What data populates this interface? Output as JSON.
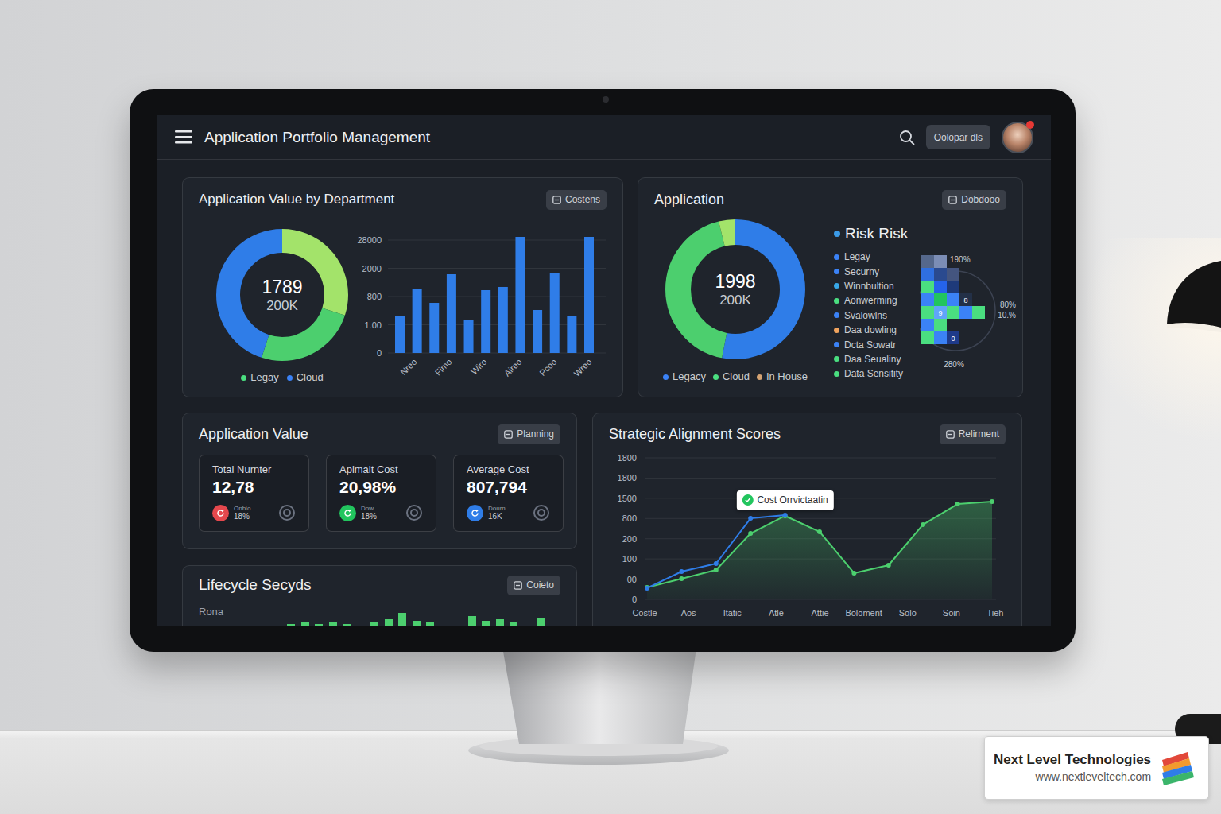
{
  "header": {
    "title": "Application Portfolio Management",
    "button": "Oolopar dls",
    "notification": true
  },
  "department_value": {
    "title": "Application Value by Department",
    "button": "Costens",
    "donut": {
      "value": "1789",
      "sub": "200K",
      "segments": [
        {
          "value": 30,
          "color": "#a3e36a"
        },
        {
          "value": 25,
          "color": "#4ccf6e"
        },
        {
          "value": 45,
          "color": "#2f7de8"
        }
      ]
    },
    "legend": [
      {
        "label": "Legay",
        "color": "#4ade80"
      },
      {
        "label": "Cloud",
        "color": "#3b82f6"
      }
    ],
    "bars": {
      "ticks": [
        "0",
        "1.00",
        "800",
        "2000",
        "28000"
      ],
      "max": 2800,
      "values": [
        907,
        1597,
        1242,
        1952,
        828,
        1558,
        1637,
        2879,
        1065,
        1972,
        927,
        2879
      ],
      "labels": [
        "Nreo",
        "Fimo",
        "Wiro",
        "Aireo",
        "Pcoo",
        "Wreo"
      ]
    }
  },
  "application": {
    "title": "Application",
    "button": "Dobdooo",
    "donut": {
      "value": "1998",
      "sub": "200K",
      "segments": [
        {
          "value": 53,
          "color": "#2f7de8"
        },
        {
          "value": 43,
          "color": "#4ccf6e"
        },
        {
          "value": 4,
          "color": "#a3e36a"
        }
      ]
    },
    "legend": [
      {
        "label": "Legacy",
        "color": "#3b82f6"
      },
      {
        "label": "Cloud",
        "color": "#4ade80"
      },
      {
        "label": "In House",
        "color": "#d4a373"
      }
    ],
    "risk": {
      "title": "Risk Risk",
      "items": [
        {
          "label": "Legay",
          "color": "#3b82f6"
        },
        {
          "label": "Securny",
          "color": "#3b82f6"
        },
        {
          "label": "Winnbultion",
          "color": "#38a8e8"
        },
        {
          "label": "Aonwerming",
          "color": "#4ade80"
        },
        {
          "label": "Svalowlns",
          "color": "#3b82f6"
        },
        {
          "label": "Daa dowling",
          "color": "#f0a35e"
        },
        {
          "label": "Dcta Sowatr",
          "color": "#3b82f6"
        },
        {
          "label": "Daa Seualiny",
          "color": "#4ade80"
        },
        {
          "label": "Data Sensitity",
          "color": "#4ade80"
        }
      ]
    },
    "matrix": {
      "top": "190%",
      "bottom": "280%",
      "right": [
        "80%",
        "10.%"
      ],
      "markers": [
        "8",
        "9",
        "0"
      ],
      "cells": [
        [
          "#55688c",
          "#7b8db5",
          "",
          "",
          ""
        ],
        [
          "#2f6fe0",
          "#2a4a8f",
          "#44557f",
          "",
          ""
        ],
        [
          "#4ade80",
          "#2563eb",
          "#1e3a7a",
          "",
          ""
        ],
        [
          "#3b82f6",
          "#22c55e",
          "#3b82f6",
          "#233047",
          ""
        ],
        [
          "#4ade80",
          "#60a5fa",
          "#4ade80",
          "#3b82f6",
          "#4ade80"
        ],
        [
          "#3b82f6",
          "#4ade80",
          "",
          "",
          ""
        ],
        [
          "#4ade80",
          "#3b82f6",
          "#1e3a8a",
          "",
          ""
        ]
      ]
    }
  },
  "application_value": {
    "title": "Application Value",
    "button": "Planning",
    "stats": [
      {
        "label": "Total Nurnter",
        "value": "12,78",
        "caption": "Onbio",
        "change": "18%",
        "color": "#e5484d"
      },
      {
        "label": "Apimalt Cost",
        "value": "20,98%",
        "caption": "Dow",
        "change": "18%",
        "color": "#22c55e"
      },
      {
        "label": "Average Cost",
        "value": "807,794",
        "caption": "Dourn",
        "change": "16K",
        "color": "#2f7de8"
      }
    ]
  },
  "alignment": {
    "title": "Strategic Alignment Scores",
    "button": "Relirment",
    "ticks": [
      "1800",
      "1800",
      "1500",
      "800",
      "200",
      "100",
      "00",
      "0"
    ],
    "max": 1800,
    "labels": [
      "Costle",
      "Aos",
      "Itatic",
      "Atle",
      "Attie",
      "Boloment",
      "Solo",
      "Soin",
      "Tieh"
    ],
    "series": [
      {
        "color": "#2f7de8",
        "values": [
          142,
          354,
          455,
          1031,
          1072
        ]
      },
      {
        "color": "#4ccf6e",
        "values": [
          152,
          263,
          374,
          839,
          1062,
          860,
          334,
          435,
          951,
          1213,
          1244
        ]
      }
    ],
    "tooltip": {
      "text": "Cost Orrvictaatin",
      "point": 4
    }
  },
  "lifecycle": {
    "title": "Lifecycle Secyds",
    "button": "Coieto",
    "label": "Rona",
    "bars": [
      {
        "value": 4,
        "color": "#8b5cf6"
      },
      {
        "value": 0,
        "color": "#4ccf6e"
      },
      {
        "value": 0,
        "color": "#4ccf6e"
      },
      {
        "value": 3,
        "color": "#4ccf6e"
      },
      {
        "value": 6,
        "color": "#4ccf6e"
      },
      {
        "value": 8,
        "color": "#4ccf6e"
      },
      {
        "value": 6,
        "color": "#4ccf6e"
      },
      {
        "value": 8,
        "color": "#4ccf6e"
      },
      {
        "value": 6,
        "color": "#4ccf6e"
      },
      {
        "value": 2,
        "color": "#4ccf6e"
      },
      {
        "value": 8,
        "color": "#4ccf6e"
      },
      {
        "value": 12,
        "color": "#4ccf6e"
      },
      {
        "value": 20,
        "color": "#4ccf6e"
      },
      {
        "value": 10,
        "color": "#4ccf6e"
      },
      {
        "value": 8,
        "color": "#4ccf6e"
      },
      {
        "value": 4,
        "color": "#4ccf6e"
      },
      {
        "value": 0,
        "color": "#4ccf6e"
      },
      {
        "value": 16,
        "color": "#4ccf6e"
      },
      {
        "value": 10,
        "color": "#4ccf6e"
      },
      {
        "value": 12,
        "color": "#4ccf6e"
      },
      {
        "value": 8,
        "color": "#4ccf6e"
      },
      {
        "value": 4,
        "color": "#4ccf6e"
      },
      {
        "value": 14,
        "color": "#4ccf6e"
      }
    ]
  },
  "badge": {
    "title": "Next Level Technologies",
    "url": "www.nextleveltech.com"
  }
}
